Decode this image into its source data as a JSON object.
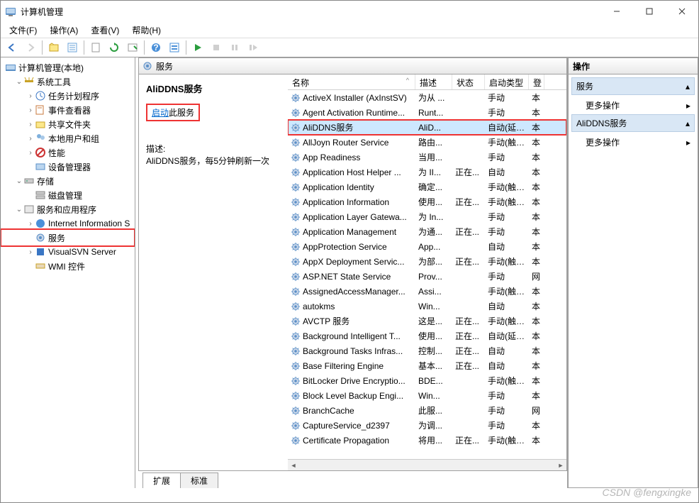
{
  "window": {
    "title": "计算机管理"
  },
  "menu": {
    "file": "文件(F)",
    "action": "操作(A)",
    "view": "查看(V)",
    "help": "帮助(H)"
  },
  "tree": {
    "root": "计算机管理(本地)",
    "systools": "系统工具",
    "taskscheduler": "任务计划程序",
    "eventviewer": "事件查看器",
    "sharedfolders": "共享文件夹",
    "localusers": "本地用户和组",
    "performance": "性能",
    "devmgr": "设备管理器",
    "storage": "存储",
    "diskmgmt": "磁盘管理",
    "servicesapps": "服务和应用程序",
    "iis": "Internet Information S",
    "services": "服务",
    "visualsvn": "VisualSVN Server",
    "wmi": "WMI 控件"
  },
  "mid": {
    "header": "服务",
    "detail_title": "AliDDNS服务",
    "start_prefix": "启动",
    "start_suffix": "此服务",
    "desc_label": "描述:",
    "desc_text": "AliDDNS服务，每5分钟刷新一次"
  },
  "cols": {
    "name": "名称",
    "desc": "描述",
    "status": "状态",
    "start": "启动类型",
    "login": "登"
  },
  "rows": [
    {
      "n": "ActiveX Installer (AxInstSV)",
      "d": "为从 ...",
      "s": "",
      "t": "手动",
      "l": "本"
    },
    {
      "n": "Agent Activation Runtime...",
      "d": "Runt...",
      "s": "",
      "t": "手动",
      "l": "本"
    },
    {
      "n": "AliDDNS服务",
      "d": "AliD...",
      "s": "",
      "t": "自动(延迟...",
      "l": "本",
      "sel": true
    },
    {
      "n": "AllJoyn Router Service",
      "d": "路由...",
      "s": "",
      "t": "手动(触发...",
      "l": "本"
    },
    {
      "n": "App Readiness",
      "d": "当用...",
      "s": "",
      "t": "手动",
      "l": "本"
    },
    {
      "n": "Application Host Helper ...",
      "d": "为 II...",
      "s": "正在...",
      "t": "自动",
      "l": "本"
    },
    {
      "n": "Application Identity",
      "d": "确定...",
      "s": "",
      "t": "手动(触发...",
      "l": "本"
    },
    {
      "n": "Application Information",
      "d": "使用...",
      "s": "正在...",
      "t": "手动(触发...",
      "l": "本"
    },
    {
      "n": "Application Layer Gatewa...",
      "d": "为 In...",
      "s": "",
      "t": "手动",
      "l": "本"
    },
    {
      "n": "Application Management",
      "d": "为通...",
      "s": "正在...",
      "t": "手动",
      "l": "本"
    },
    {
      "n": "AppProtection Service",
      "d": "App...",
      "s": "",
      "t": "自动",
      "l": "本"
    },
    {
      "n": "AppX Deployment Servic...",
      "d": "为部...",
      "s": "正在...",
      "t": "手动(触发...",
      "l": "本"
    },
    {
      "n": "ASP.NET State Service",
      "d": "Prov...",
      "s": "",
      "t": "手动",
      "l": "网"
    },
    {
      "n": "AssignedAccessManager...",
      "d": "Assi...",
      "s": "",
      "t": "手动(触发...",
      "l": "本"
    },
    {
      "n": "autokms",
      "d": "Win...",
      "s": "",
      "t": "自动",
      "l": "本"
    },
    {
      "n": "AVCTP 服务",
      "d": "这是...",
      "s": "正在...",
      "t": "手动(触发...",
      "l": "本"
    },
    {
      "n": "Background Intelligent T...",
      "d": "使用...",
      "s": "正在...",
      "t": "自动(延迟...",
      "l": "本"
    },
    {
      "n": "Background Tasks Infras...",
      "d": "控制...",
      "s": "正在...",
      "t": "自动",
      "l": "本"
    },
    {
      "n": "Base Filtering Engine",
      "d": "基本...",
      "s": "正在...",
      "t": "自动",
      "l": "本"
    },
    {
      "n": "BitLocker Drive Encryptio...",
      "d": "BDE...",
      "s": "",
      "t": "手动(触发...",
      "l": "本"
    },
    {
      "n": "Block Level Backup Engi...",
      "d": "Win...",
      "s": "",
      "t": "手动",
      "l": "本"
    },
    {
      "n": "BranchCache",
      "d": "此服...",
      "s": "",
      "t": "手动",
      "l": "网"
    },
    {
      "n": "CaptureService_d2397",
      "d": "为调...",
      "s": "",
      "t": "手动",
      "l": "本"
    },
    {
      "n": "Certificate Propagation",
      "d": "将用...",
      "s": "正在...",
      "t": "手动(触发...",
      "l": "本"
    }
  ],
  "tabs": {
    "extended": "扩展",
    "standard": "标准"
  },
  "actions": {
    "title": "操作",
    "group1": "服务",
    "more": "更多操作",
    "group2": "AliDDNS服务"
  },
  "watermark": "CSDN @fengxingke"
}
